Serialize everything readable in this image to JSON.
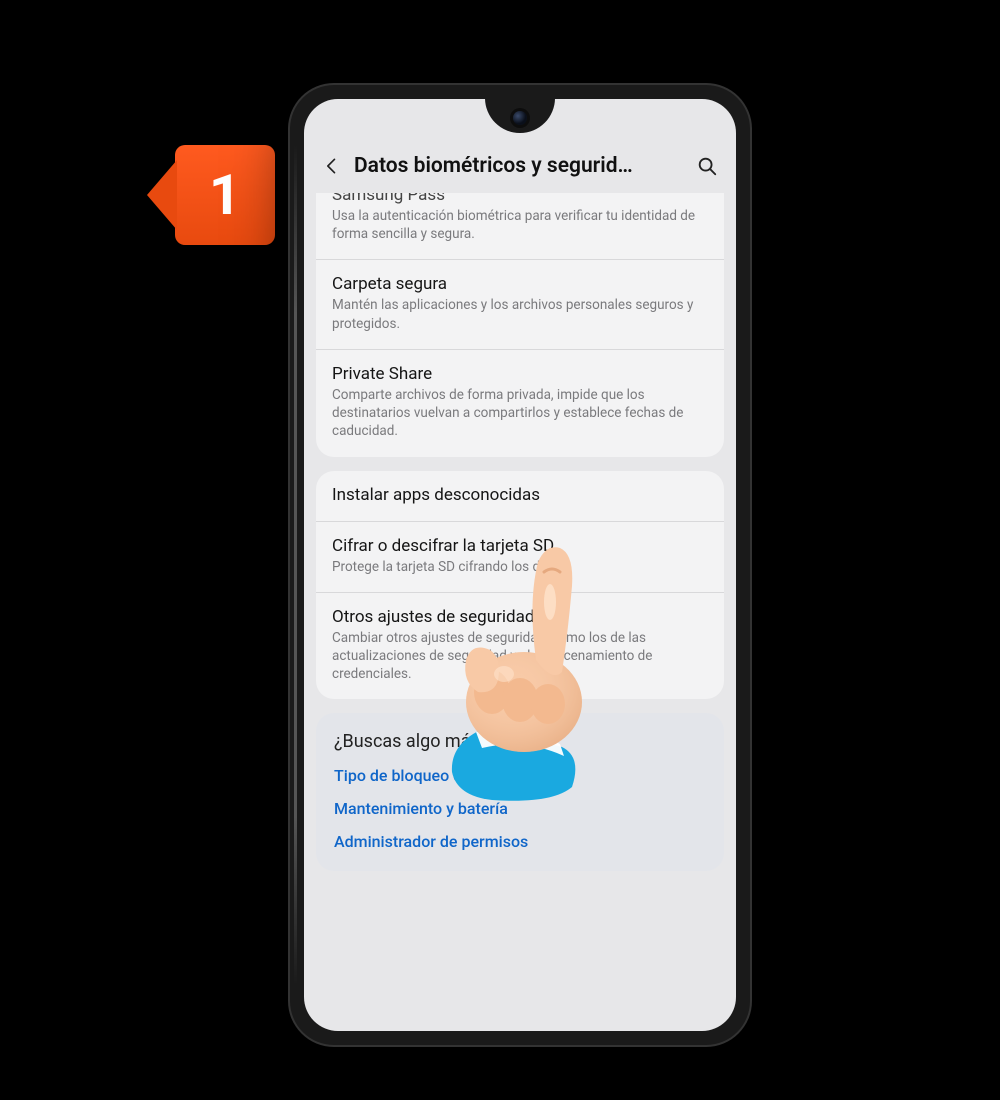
{
  "step_number": "1",
  "header": {
    "title": "Datos biométricos y segurid…"
  },
  "group1": {
    "samsung_pass": {
      "title": "Samsung Pass",
      "desc": "Usa la autenticación biométrica para verificar tu identidad de forma sencilla y segura."
    },
    "secure_folder": {
      "title": "Carpeta segura",
      "desc": "Mantén las aplicaciones y los archivos personales seguros y protegidos."
    },
    "private_share": {
      "title": "Private Share",
      "desc": "Comparte archivos de forma privada, impide que los destinatarios vuelvan a compartirlos y establece fechas de caducidad."
    }
  },
  "group2": {
    "unknown_apps": {
      "title": "Instalar apps desconocidas"
    },
    "sd_encrypt": {
      "title": "Cifrar o descifrar la tarjeta SD",
      "desc": "Protege la tarjeta SD cifrando los datos."
    },
    "other_security": {
      "title": "Otros ajustes de seguridad",
      "desc": "Cambiar otros ajustes de seguridad, como los de las actualizaciones de seguridad y el almacenamiento de credenciales."
    }
  },
  "suggestions": {
    "heading": "¿Buscas algo más?",
    "links": [
      "Tipo de bloqueo de pantalla",
      "Mantenimiento y batería",
      "Administrador de permisos"
    ]
  }
}
